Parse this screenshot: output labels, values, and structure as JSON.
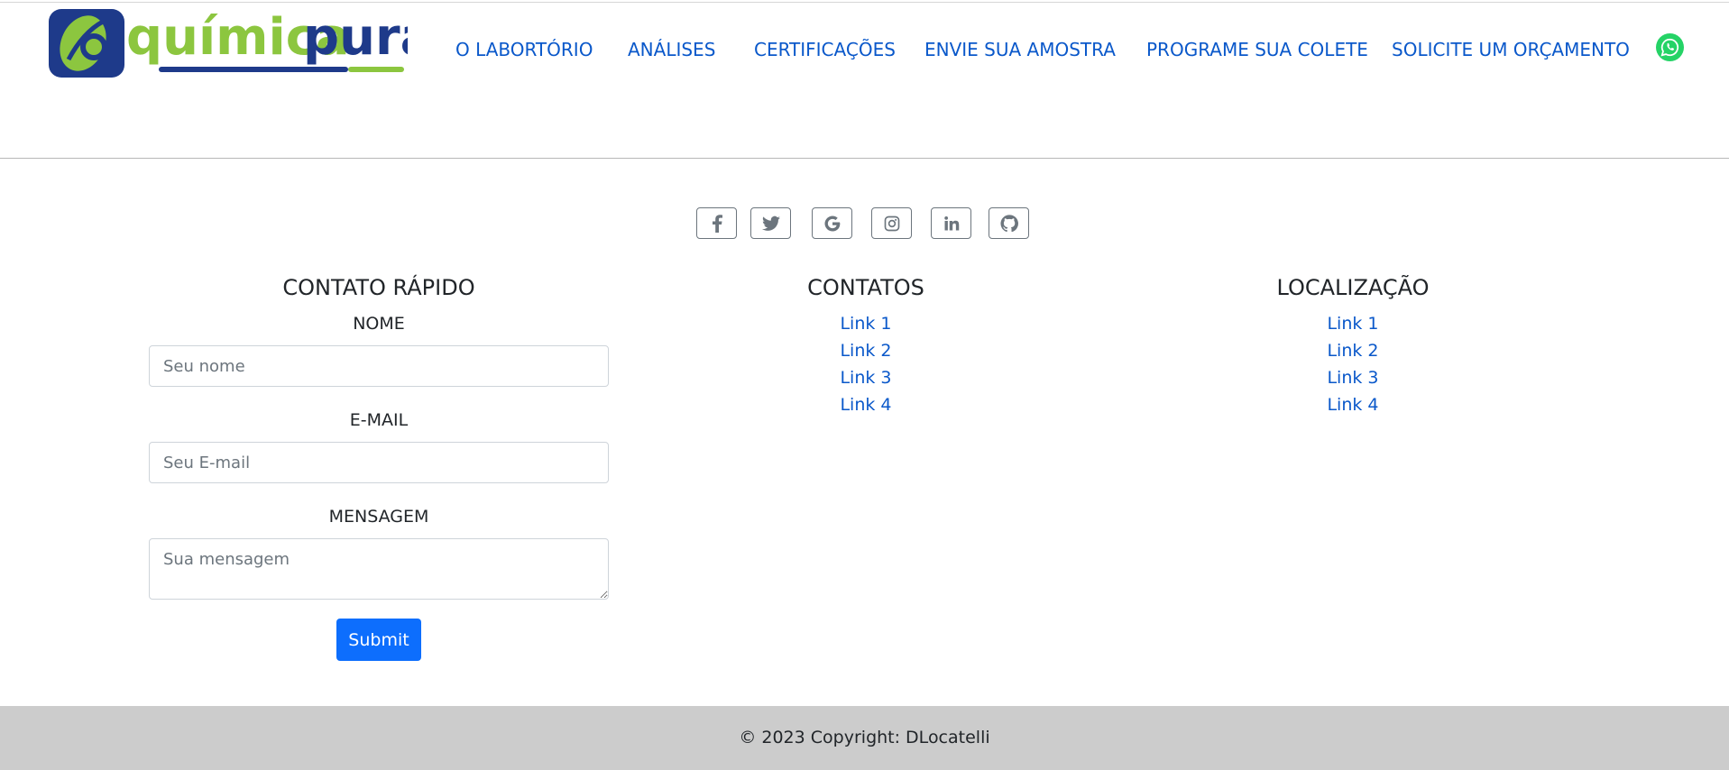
{
  "brand": {
    "logo_text_left": "química",
    "logo_text_right": "pura",
    "colors": {
      "navy": "#1e3a8a",
      "green": "#8cc63f"
    }
  },
  "nav": {
    "items": [
      {
        "label": "O LABORTÓRIO"
      },
      {
        "label": "ANÁLISES"
      },
      {
        "label": "CERTIFICAÇÕES"
      },
      {
        "label": "ENVIE SUA AMOSTRA"
      },
      {
        "label": "PROGRAME SUA COLETE"
      },
      {
        "label": "SOLICITE UM ORÇAMENTO"
      }
    ],
    "whatsapp_icon": "whatsapp-icon",
    "link_color": "#0a58ca"
  },
  "social": {
    "icons": [
      "facebook-icon",
      "twitter-icon",
      "google-icon",
      "instagram-icon",
      "linkedin-icon",
      "github-icon"
    ]
  },
  "contact_form": {
    "heading": "CONTATO RÁPIDO",
    "name_label": "NOME",
    "name_placeholder": "Seu nome",
    "email_label": "E-MAIL",
    "email_placeholder": "Seu E-mail",
    "message_label": "MENSAGEM",
    "message_placeholder": "Sua mensagem",
    "submit_label": "Submit",
    "submit_color": "#0d6efd"
  },
  "contacts": {
    "heading": "CONTATOS",
    "links": [
      {
        "label": "Link 1"
      },
      {
        "label": "Link 2"
      },
      {
        "label": "Link 3"
      },
      {
        "label": "Link 4"
      }
    ]
  },
  "location": {
    "heading": "LOCALIZAÇÃO",
    "links": [
      {
        "label": "Link 1"
      },
      {
        "label": "Link 2"
      },
      {
        "label": "Link 3"
      },
      {
        "label": "Link 4"
      }
    ]
  },
  "footer": {
    "copyright": "© 2023 Copyright: DLocatelli"
  }
}
